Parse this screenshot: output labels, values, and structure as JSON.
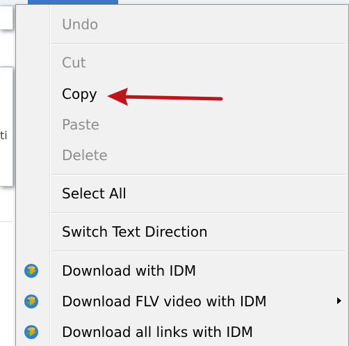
{
  "menu": {
    "items": [
      {
        "label": "Undo",
        "enabled": false
      },
      {
        "label": "Cut",
        "enabled": false
      },
      {
        "label": "Copy",
        "enabled": true
      },
      {
        "label": "Paste",
        "enabled": false
      },
      {
        "label": "Delete",
        "enabled": false
      },
      {
        "label": "Select All",
        "enabled": true
      },
      {
        "label": "Switch Text Direction",
        "enabled": true
      },
      {
        "label": "Download with IDM",
        "enabled": true,
        "icon": "idm-icon"
      },
      {
        "label": "Download FLV video with IDM",
        "enabled": true,
        "icon": "idm-icon",
        "has_submenu": true
      },
      {
        "label": "Download all links with IDM",
        "enabled": true,
        "icon": "idm-icon"
      }
    ]
  },
  "annotation": {
    "type": "red-arrow",
    "points_to": "Copy",
    "color": "#c0141c"
  },
  "background": {
    "partial_text": "ti"
  }
}
